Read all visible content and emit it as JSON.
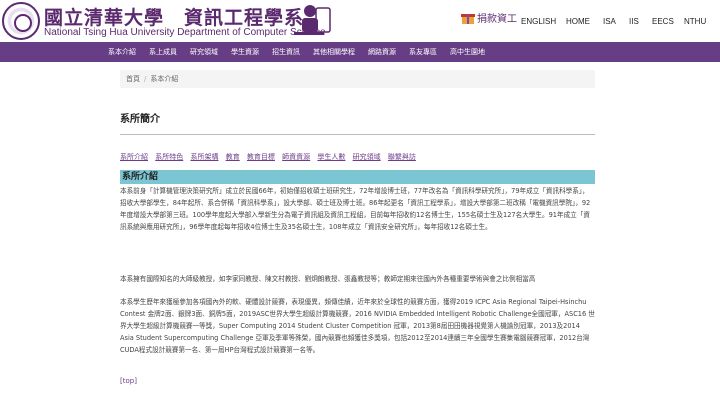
{
  "header": {
    "logo_zh": "國立清華大學　資訊工程學系",
    "logo_en": "National Tsing Hua University Department of Computer Science",
    "donate": "捐款資工",
    "top_links": [
      "ENGLISH",
      "HOME",
      "ISA",
      "IIS",
      "EECS",
      "NTHU"
    ]
  },
  "nav": [
    "系本介紹",
    "系上成員",
    "研究領域",
    "學生資源",
    "招生資訊",
    "其他相關學程",
    "網路資源",
    "系友專區",
    "高中生園地"
  ],
  "breadcrumb": [
    "首頁",
    "系本介紹"
  ],
  "page_title": "系所簡介",
  "subnav": [
    "系所介紹",
    "系所特色",
    "系所架構",
    "教育",
    "教育目標",
    "師資資源",
    "學生人數",
    "研究領域",
    "聯繫與訪"
  ],
  "section_title": "系所介紹",
  "paragraphs": [
    "本系前身「計算機管理決策研究所」成立於民國66年，初始僅招收碩士班研究生，72年增設博士班，77年改名為「資訊科學研究所」，79年成立「資訊科學系」，招收大學部學生，84年起所、系合併稱「資訊科學系」，設大學部、碩士班及博士班。86年起更名「資訊工程學系」，增設大學部第二班改稱「電機資訊學院」，92年度增設大學部第三班。100學年度起大學部入學新生分為電子資訊組及資訊工程組，目前每年招收約12名博士生，155名碩士生及127名大學生。91年成立「資訊系統與應用研究所」，96學年度起每年招收4位博士生及35名碩士生，108年成立「資訊安全研究所」，每年招收12名碩士生。",
    "本系擁有國際知名的大師級教授，如李家同教授、陳文村教授、劉炯朗教授、張鑫教授等；教師定期來往國內外各種重要學術與會之比例相當高",
    "本系學生歷年來獲極參加各項國內外的軟、硬體設計競賽，表現優異，頻傳佳績，近年來於全球性的競賽方面，獲得2019 ICPC Asia Regional Taipei-Hsinchu Contest 金牌2面、銀牌3面、銅牌5面，2019ASC世界大學生超級計算機競賽，2016 NVIDIA Embedded Intelligent Robotic Challenge全國冠軍，ASC16 世界大學生超級計算機競賽一等獎，Super Computing 2014 Student Cluster Competition 冠軍，2013第8屆田田機器視覺第人機論別冠軍，2013及2014 Asia Student Supercomputing Challenge 亞軍及季軍等殊榮，國內競賽也頻獲佳多獎項，包括2012至2014連續三年全國學生賽集電腦競賽冠軍，2012台灣CUDA程式設計競賽第一名、第一屆HP台灣程式設計競賽第一名等。"
  ],
  "top_link": "[top]",
  "colors": {
    "brand_purple": "#673d86",
    "section_teal": "#7cc6d4",
    "link_purple": "#6d3c8c"
  }
}
